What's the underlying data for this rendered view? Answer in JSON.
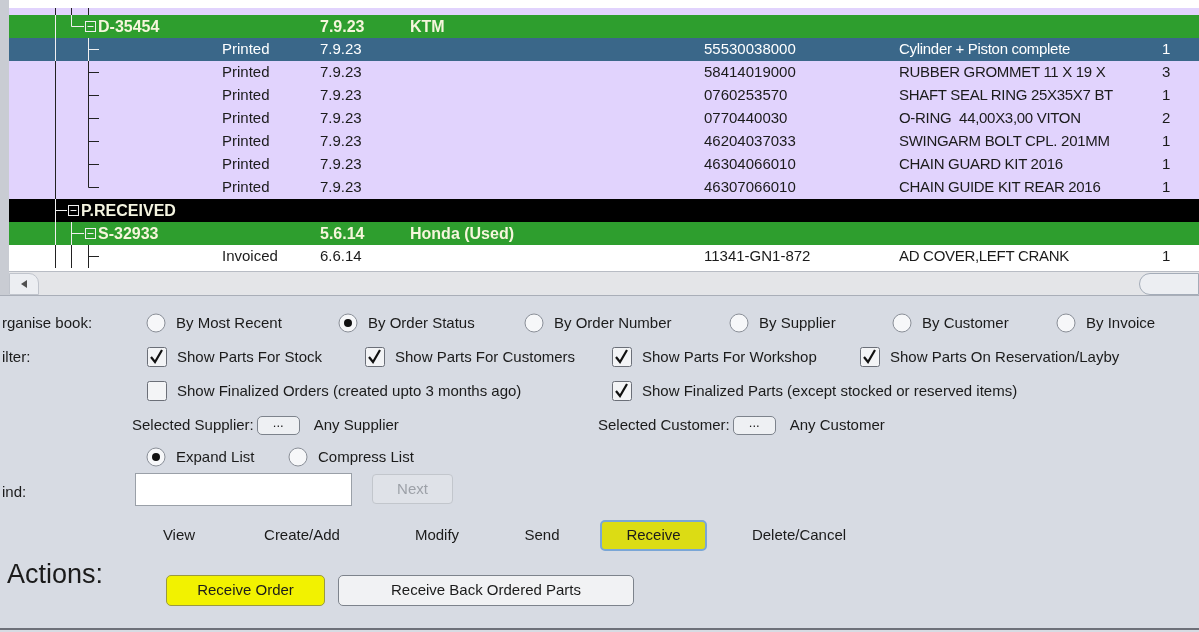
{
  "orders_tree": [
    {
      "kind": "order",
      "label": "D-35454",
      "date": "7.9.23",
      "supplier": "KTM",
      "expanded": true,
      "children": [
        {
          "kind": "item",
          "status": "Printed",
          "date": "7.9.23",
          "part_no": "55530038000",
          "description": "Cylinder + Piston complete",
          "qty": "1",
          "selected": true
        },
        {
          "kind": "item",
          "status": "Printed",
          "date": "7.9.23",
          "part_no": "58414019000",
          "description": "RUBBER GROMMET 11 X 19 X",
          "qty": "3",
          "color": "#e1d3fd",
          "selected": false
        },
        {
          "kind": "item",
          "status": "Printed",
          "date": "7.9.23",
          "part_no": "0760253570",
          "description": "SHAFT SEAL RING 25X35X7 BT",
          "qty": "1",
          "color": "#e1d3fd",
          "selected": false
        },
        {
          "kind": "item",
          "status": "Printed",
          "date": "7.9.23",
          "part_no": "0770440030",
          "description": "O-RING  44,00X3,00 VITON",
          "qty": "2",
          "color": "#e1d3fd",
          "selected": false
        },
        {
          "kind": "item",
          "status": "Printed",
          "date": "7.9.23",
          "part_no": "46204037033",
          "description": "SWINGARM BOLT CPL. 201MM",
          "qty": "1",
          "color": "#e1d3fd",
          "selected": false
        },
        {
          "kind": "item",
          "status": "Printed",
          "date": "7.9.23",
          "part_no": "46304066010",
          "description": "CHAIN GUARD KIT 2016",
          "qty": "1",
          "color": "#e1d3fd",
          "selected": false
        },
        {
          "kind": "item",
          "status": "Printed",
          "date": "7.9.23",
          "part_no": "46307066010",
          "description": "CHAIN GUIDE KIT REAR 2016",
          "qty": "1",
          "color": "#e1d3fd",
          "selected": false
        }
      ]
    },
    {
      "kind": "status",
      "label": "P.RECEIVED",
      "expanded": true,
      "children": [
        {
          "kind": "order",
          "label": "S-32933",
          "date": "5.6.14",
          "supplier": "Honda (Used)",
          "expanded": true,
          "children": [
            {
              "kind": "item",
              "status": "Invoiced",
              "date": "6.6.14",
              "part_no": "11341-GN1-872",
              "description": "AD COVER,LEFT CRANK",
              "qty": "1",
              "color": "#ffffff",
              "selected": false
            }
          ]
        }
      ]
    }
  ],
  "organise": {
    "label": "rganise book:",
    "options": [
      {
        "label": "By Most Recent",
        "selected": false
      },
      {
        "label": "By Order Status",
        "selected": true
      },
      {
        "label": "By Order Number",
        "selected": false
      },
      {
        "label": "By Supplier",
        "selected": false
      },
      {
        "label": "By Customer",
        "selected": false
      },
      {
        "label": "By Invoice",
        "selected": false
      }
    ]
  },
  "filter": {
    "label": "ilter:",
    "checkboxes": [
      {
        "label": "Show Parts For Stock",
        "checked": true
      },
      {
        "label": "Show Parts For Customers",
        "checked": true
      },
      {
        "label": "Show Parts For Workshop",
        "checked": true
      },
      {
        "label": "Show Parts On Reservation/Layby",
        "checked": true
      },
      {
        "label": "Show Finalized Orders (created upto 3 months ago)",
        "checked": false
      },
      {
        "label": "Show Finalized Parts (except stocked or reserved items)",
        "checked": true
      }
    ]
  },
  "selectors": [
    {
      "label": "Selected Supplier:",
      "button": "...",
      "value": "Any Supplier"
    },
    {
      "label": "Selected Customer:",
      "button": "...",
      "value": "Any Customer"
    }
  ],
  "list_mode": [
    {
      "label": "Expand List",
      "selected": true
    },
    {
      "label": "Compress List",
      "selected": false
    }
  ],
  "find": {
    "label": "ind:",
    "button": {
      "label": "Next",
      "disabled": true
    }
  },
  "action_tabs": [
    {
      "label": "View",
      "selected": false
    },
    {
      "label": "Create/Add",
      "selected": false
    },
    {
      "label": "Modify",
      "selected": false
    },
    {
      "label": "Send",
      "selected": false
    },
    {
      "label": "Receive",
      "selected": true
    },
    {
      "label": "Delete/Cancel",
      "selected": false
    }
  ],
  "actions": {
    "label": "Actions:",
    "buttons": [
      {
        "label": "Receive Order",
        "highlighted": true
      },
      {
        "label": "Receive Back Ordered Parts",
        "highlighted": false
      }
    ]
  }
}
